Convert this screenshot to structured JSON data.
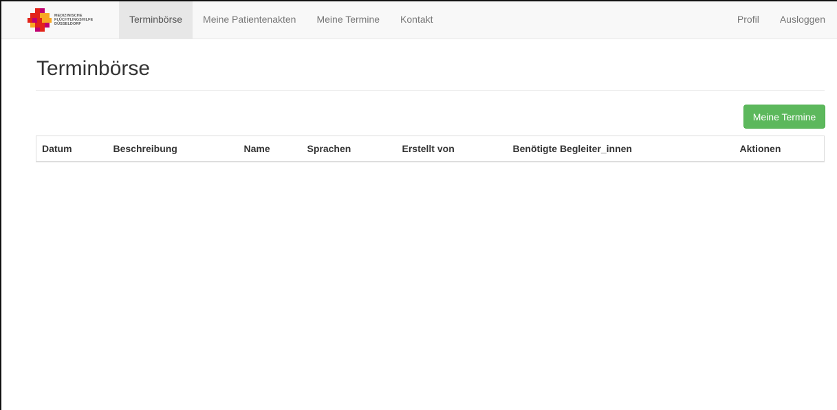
{
  "brand": {
    "lines": [
      "MEDIZINISCHE",
      "FLÜCHTLINGSHILFE",
      "DÜSSELDORF"
    ],
    "colors": [
      "#e2231a",
      "#f7a823",
      "#c0006f"
    ]
  },
  "nav": {
    "left": [
      {
        "label": "Terminbörse",
        "active": true
      },
      {
        "label": "Meine Patientenakten"
      },
      {
        "label": "Meine Termine"
      },
      {
        "label": "Kontakt"
      }
    ],
    "right": [
      {
        "label": "Profil"
      },
      {
        "label": "Ausloggen"
      }
    ]
  },
  "page": {
    "title": "Terminbörse",
    "primary_button": "Meine Termine",
    "accent_color": "#5cb85c"
  },
  "table": {
    "columns": [
      "Datum",
      "Beschreibung",
      "Name",
      "Sprachen",
      "Erstellt von",
      "Benötigte Begleiter_innen",
      "Aktionen"
    ],
    "rows": []
  }
}
